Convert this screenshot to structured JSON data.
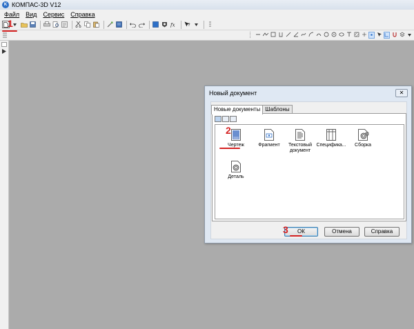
{
  "window": {
    "title": "КОМПАС-3D V12",
    "app_icon_text": "K"
  },
  "menu": {
    "items": [
      "Файл",
      "Вид",
      "Сервис",
      "Справка"
    ]
  },
  "dialog": {
    "title": "Новый документ",
    "close_glyph": "✕",
    "tabs": [
      {
        "label": "Новые документы",
        "active": true
      },
      {
        "label": "Шаблоны",
        "active": false
      }
    ],
    "items": [
      {
        "label": "Чертеж",
        "icon": "drawing-icon"
      },
      {
        "label": "Фрагмент",
        "icon": "fragment-icon"
      },
      {
        "label": "Текстовый документ",
        "icon": "text-document-icon"
      },
      {
        "label": "Спецификa...",
        "icon": "specification-icon"
      },
      {
        "label": "Сборка",
        "icon": "assembly-icon"
      },
      {
        "label": "Деталь",
        "icon": "part-icon"
      }
    ],
    "buttons": {
      "ok": "ОК",
      "cancel": "Отмена",
      "help": "Справка"
    }
  },
  "annotations": {
    "step1": "1",
    "step2": "2",
    "step3": "3"
  },
  "colors": {
    "annotation": "#d42020",
    "workspace": "#ababab",
    "dialog_bg": "#dfe8f3"
  }
}
